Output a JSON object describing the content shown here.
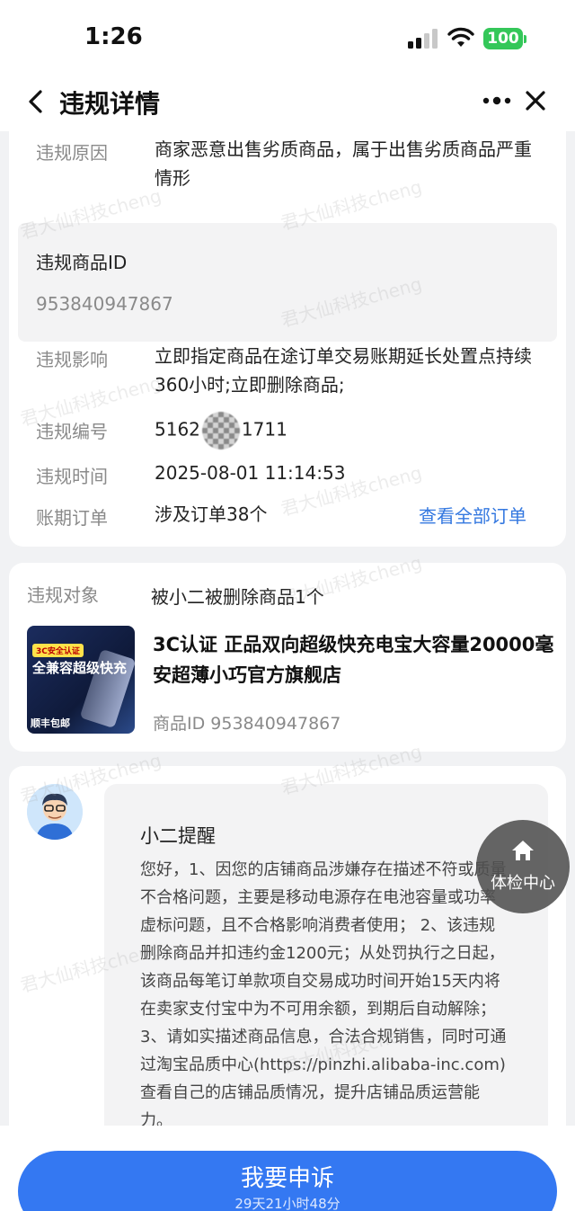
{
  "status_bar": {
    "time": "1:26",
    "battery": "100"
  },
  "nav": {
    "title": "违规详情"
  },
  "details": {
    "reason_label": "违规原因",
    "reason_value": "商家恶意出售劣质商品，属于出售劣质商品严重情形",
    "product_id_label": "违规商品ID",
    "product_id_value": "953840947867",
    "impact_label": "违规影响",
    "impact_value": "立即指定商品在途订单交易账期延长处置点持续360小时;立即删除商品;",
    "number_label": "违规编号",
    "number_prefix": "5162",
    "number_suffix": "1711",
    "time_label": "违规时间",
    "time_value": "2025-08-01 11:14:53",
    "orders_label": "账期订单",
    "orders_value": "涉及订单38个",
    "orders_link": "查看全部订单"
  },
  "target": {
    "label": "违规对象",
    "value": "被小二被删除商品1个",
    "product_image_badge": "3C安全认证",
    "product_image_text": "全兼容超级快充",
    "product_image_footer": "顺丰包邮",
    "product_title": "3C认证 正品双向超级快充电宝大容量20000毫安超薄小巧官方旗舰店",
    "product_id": "商品ID 953840947867"
  },
  "reminder": {
    "title": "小二提醒",
    "text": "您好，1、因您的店铺商品涉嫌存在描述不符或质量不合格问题，主要是移动电源存在电池容量或功率虚标问题，且不合格影响消费者使用； 2、该违规删除商品并扣违约金1200元；从处罚执行之日起，该商品每笔订单款项自交易成功时间开始15天内将在卖家支付宝中为不可用余额，到期后自动解除； 3、请如实描述商品信息，合法合规销售，同时可通过淘宝品质中心(https://pinzhi.alibaba-inc.com)查看自己的店铺品质情况，提升店铺品质运营能力。"
  },
  "fab": {
    "label": "体检中心"
  },
  "appeal": {
    "label": "我要申诉",
    "countdown": "29天21小时48分"
  },
  "watermark": "君大仙科技cheng",
  "colors": {
    "primary_blue": "#3478f2",
    "link_blue": "#3478e0",
    "battery_green": "#34c759"
  }
}
